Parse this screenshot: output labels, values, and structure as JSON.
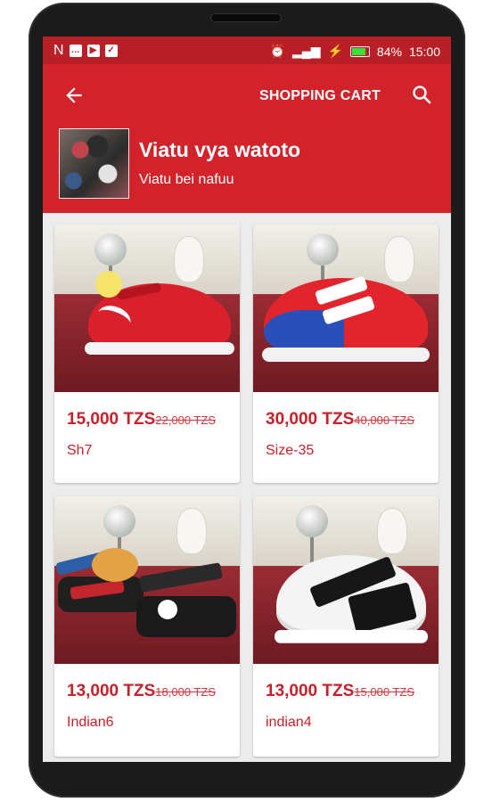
{
  "status_bar": {
    "left_icons": [
      "N",
      "chat-icon",
      "youtube-icon",
      "check-icon"
    ],
    "battery_percent": "84%",
    "time": "15:00"
  },
  "toolbar": {
    "title": "SHOPPING CART",
    "back_icon": "arrow-left-icon",
    "search_icon": "search-icon"
  },
  "store": {
    "name": "Viatu vya watoto",
    "subtitle": "Viatu bei nafuu"
  },
  "products": [
    {
      "price": "15,000 TZS",
      "old_price": "22,000 TZS",
      "name": "Sh7"
    },
    {
      "price": "30,000 TZS",
      "old_price": "40,000 TZS",
      "name": "Size-35"
    },
    {
      "price": "13,000 TZS",
      "old_price": "18,000 TZS",
      "name": "Indian6"
    },
    {
      "price": "13,000 TZS",
      "old_price": "15,000 TZS",
      "name": "indian4"
    }
  ],
  "colors": {
    "brand": "#d2232b",
    "status_bar": "#b81f26",
    "price": "#c8202a"
  }
}
